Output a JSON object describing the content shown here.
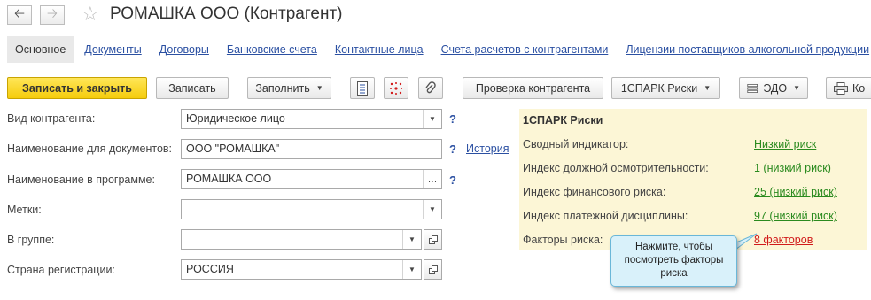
{
  "window": {
    "title": "РОМАШКА ООО (Контрагент)"
  },
  "tabs": [
    {
      "label": "Основное"
    },
    {
      "label": "Документы"
    },
    {
      "label": "Договоры"
    },
    {
      "label": "Банковские счета"
    },
    {
      "label": "Контактные лица"
    },
    {
      "label": "Счета расчетов с контрагентами"
    },
    {
      "label": "Лицензии поставщиков алкогольной продукции"
    }
  ],
  "toolbar": {
    "save_close": "Записать и закрыть",
    "save": "Записать",
    "fill": "Заполнить",
    "check": "Проверка контрагента",
    "spark": "1СПАРК Риски",
    "edo": "ЭДО",
    "print": "Ко"
  },
  "form": {
    "kind_label": "Вид контрагента:",
    "kind_value": "Юридическое лицо",
    "docname_label": "Наименование для документов:",
    "docname_value": "ООО \"РОМАШКА\"",
    "history_link": "История",
    "progname_label": "Наименование в программе:",
    "progname_value": "РОМАШКА ООО",
    "tags_label": "Метки:",
    "tags_value": "",
    "group_label": "В группе:",
    "group_value": "",
    "country_label": "Страна регистрации:",
    "country_value": "РОССИЯ",
    "help_mark": "?"
  },
  "spark_panel": {
    "title": "1СПАРК Риски",
    "rows": [
      {
        "label": "Сводный индикатор:",
        "value": "Низкий риск"
      },
      {
        "label": "Индекс должной осмотрительности:",
        "value": "1 (низкий риск)"
      },
      {
        "label": "Индекс финансового риска:",
        "value": "25 (низкий риск)"
      },
      {
        "label": "Индекс платежной дисциплины:",
        "value": "97 (низкий риск)"
      },
      {
        "label": "Факторы риска:",
        "value": "8 факторов"
      }
    ],
    "colors": {
      "ok": "#2a8a1e",
      "risk": "#d11b1b",
      "background": "#fcf6d6"
    }
  },
  "tooltip": {
    "line1": "Нажмите, чтобы",
    "line2": "посмотреть факторы",
    "line3": "риска"
  },
  "icons": {
    "back": "arrow-left-icon",
    "forward": "arrow-right-icon",
    "favorite": "star-icon",
    "report": "document-list-icon",
    "structure": "structure-dots-icon",
    "attach": "paperclip-icon",
    "edo": "stack-icon",
    "print": "printer-icon"
  }
}
